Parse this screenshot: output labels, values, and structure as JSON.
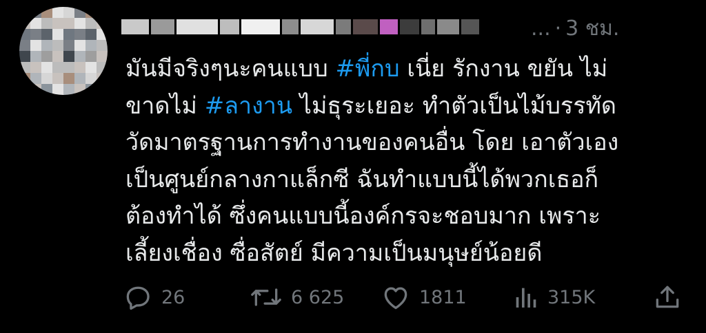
{
  "tweet": {
    "time": "3 ชม.",
    "ellipsis": "...",
    "separator": "·",
    "body_lines": [
      [
        {
          "text": "มันมีจริงๆนะคนแบบ ",
          "tag": false
        },
        {
          "text": "#พี่กบ",
          "tag": true
        },
        {
          "text": " เนี่ย รักงาน ขยัน ไม่",
          "tag": false
        }
      ],
      [
        {
          "text": "ขาดไม่ ",
          "tag": false
        },
        {
          "text": "#ลางาน",
          "tag": true
        },
        {
          "text": " ไม่ธุระเยอะ ทำตัวเป็นไม้บรรทัด",
          "tag": false
        }
      ],
      [
        {
          "text": "วัดมาตรฐานการทำงานของคนอื่น โดย เอาตัวเอง",
          "tag": false
        }
      ],
      [
        {
          "text": "เป็นศูนย์กลางกาแล็กซี ฉันทำแบบนี้ได้พวกเธอก็",
          "tag": false
        }
      ],
      [
        {
          "text": "ต้องทำได้ ซึ่งคนแบบนี้องค์กรจะชอบมาก เพราะ",
          "tag": false
        }
      ],
      [
        {
          "text": "เลี้ยงเชื่อง ซื่อสัตย์ มีความเป็นมนุษย์น้อยดี",
          "tag": false
        }
      ]
    ]
  },
  "actions": {
    "replies": "26",
    "reposts": "6 625",
    "likes": "1811",
    "views": "315K"
  },
  "colors": {
    "background": "#000000",
    "text": "#e7e9ea",
    "muted": "#71767b",
    "hashtag": "#1d9bf0"
  },
  "icons": [
    "reply-icon",
    "repost-icon",
    "like-icon",
    "views-icon",
    "share-icon"
  ]
}
